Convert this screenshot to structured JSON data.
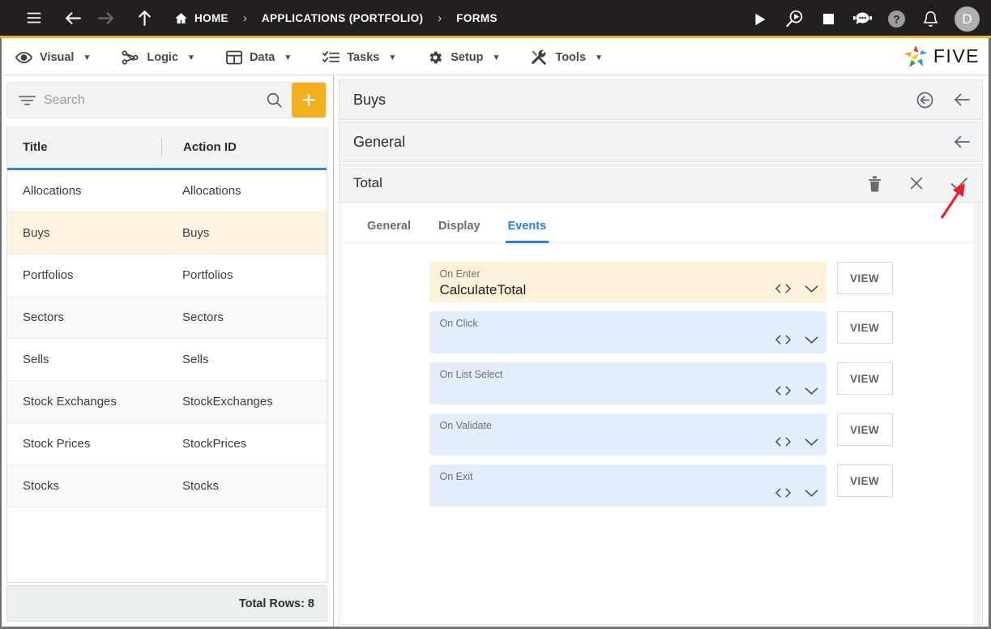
{
  "topbar": {
    "menu_icon": "hamburger-icon",
    "back_icon": "arrow-left-icon",
    "forward_icon": "arrow-right-icon",
    "up_icon": "arrow-up-icon",
    "breadcrumbs": [
      {
        "label": "HOME",
        "icon": "home-icon"
      },
      {
        "label": "APPLICATIONS (PORTFOLIO)",
        "icon": ""
      },
      {
        "label": "FORMS",
        "icon": ""
      }
    ],
    "separator": "›",
    "right_icons": [
      "run-icon",
      "debug-icon",
      "stop-icon",
      "chatbot-icon",
      "help-icon",
      "bell-icon"
    ],
    "avatar_initial": "D"
  },
  "menubar": {
    "items": [
      {
        "label": "Visual",
        "icon": "eye-icon",
        "caret": "▼"
      },
      {
        "label": "Logic",
        "icon": "logic-icon",
        "caret": "▼"
      },
      {
        "label": "Data",
        "icon": "table-icon",
        "caret": "▼"
      },
      {
        "label": "Tasks",
        "icon": "tasks-icon",
        "caret": "▼"
      },
      {
        "label": "Setup",
        "icon": "gear-icon",
        "caret": "▼"
      },
      {
        "label": "Tools",
        "icon": "tools-icon",
        "caret": "▼"
      }
    ],
    "brand": "FIVE"
  },
  "sidebar": {
    "search": {
      "placeholder": "Search",
      "value": ""
    },
    "add_label": "+",
    "columns": [
      "Title",
      "Action ID"
    ],
    "rows": [
      {
        "title": "Allocations",
        "action_id": "Allocations"
      },
      {
        "title": "Buys",
        "action_id": "Buys"
      },
      {
        "title": "Portfolios",
        "action_id": "Portfolios"
      },
      {
        "title": "Sectors",
        "action_id": "Sectors"
      },
      {
        "title": "Sells",
        "action_id": "Sells"
      },
      {
        "title": "Stock Exchanges",
        "action_id": "StockExchanges"
      },
      {
        "title": "Stock Prices",
        "action_id": "StockPrices"
      },
      {
        "title": "Stocks",
        "action_id": "Stocks"
      }
    ],
    "selected_index": 1,
    "status": "Total Rows: 8"
  },
  "main": {
    "form_title": "Buys",
    "section_title": "General",
    "field_title": "Total",
    "tabs": [
      {
        "label": "General",
        "active": false
      },
      {
        "label": "Display",
        "active": false
      },
      {
        "label": "Events",
        "active": true
      }
    ],
    "events": [
      {
        "label": "On Enter",
        "value": "CalculateTotal",
        "filled": true,
        "view_label": "VIEW"
      },
      {
        "label": "On Click",
        "value": "",
        "filled": false,
        "view_label": "VIEW"
      },
      {
        "label": "On List Select",
        "value": "",
        "filled": false,
        "view_label": "VIEW"
      },
      {
        "label": "On Validate",
        "value": "",
        "filled": false,
        "view_label": "VIEW"
      },
      {
        "label": "On Exit",
        "value": "",
        "filled": false,
        "view_label": "VIEW"
      }
    ]
  },
  "colors": {
    "brand_yellow": "#f2b01e",
    "accent_blue": "#2f7de1",
    "selected_row": "#fdf3e0",
    "event_blue": "#e3eefa",
    "event_filled": "#fdf1da",
    "annotation_red": "#ee1c25",
    "topbar_bg": "#231f20"
  }
}
